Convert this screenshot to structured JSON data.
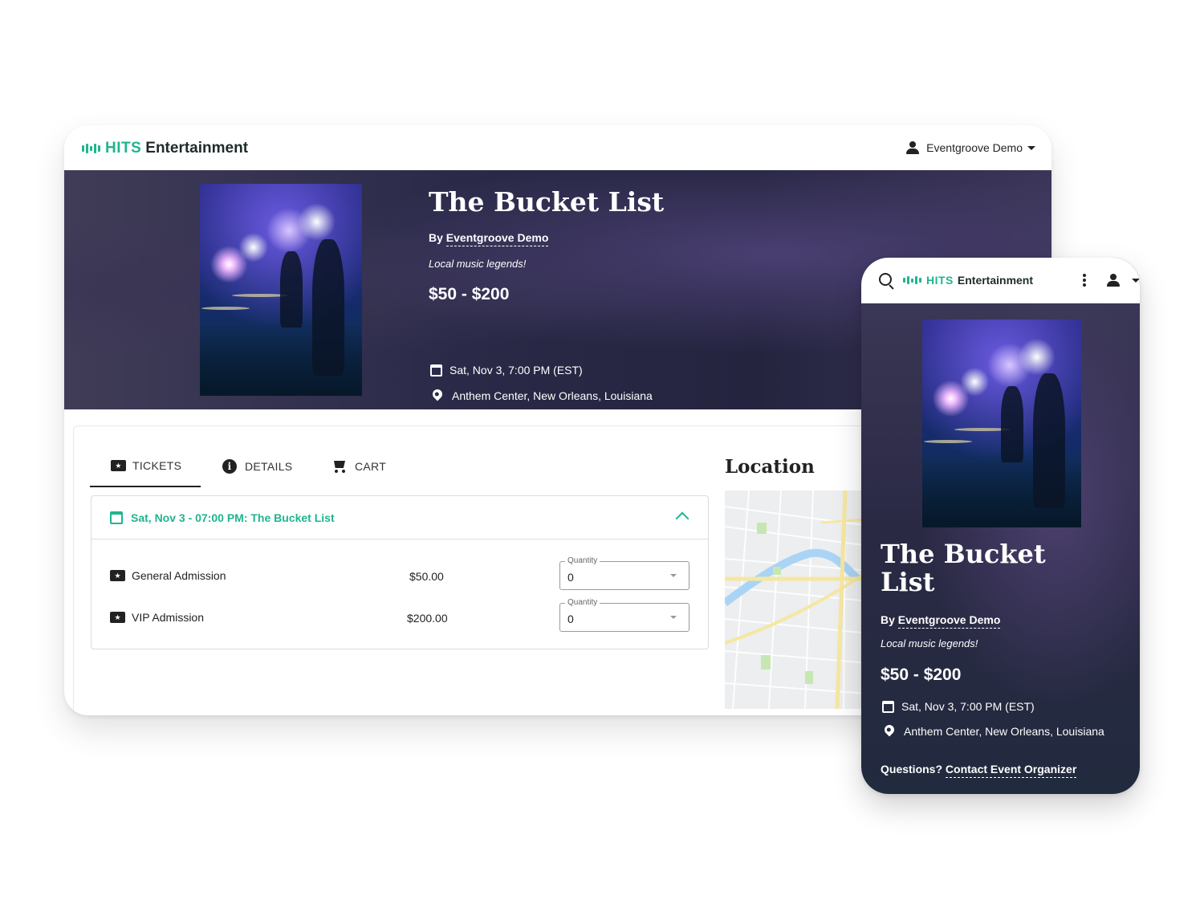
{
  "brand": {
    "hits": "HITS",
    "name": "Entertainment",
    "accent_color": "#1fb58f"
  },
  "user": {
    "name": "Eventgroove Demo"
  },
  "event": {
    "title": "The Bucket List",
    "by_prefix": "By",
    "organizer": "Eventgroove Demo",
    "tagline": "Local music legends!",
    "price_range": "$50 - $200",
    "date_time": "Sat, Nov 3, 7:00 PM (EST)",
    "location": "Anthem Center, New Orleans, Louisiana"
  },
  "tabs": [
    {
      "label": "TICKETS",
      "icon": "ticket-icon",
      "active": true
    },
    {
      "label": "DETAILS",
      "icon": "info-icon",
      "active": false
    },
    {
      "label": "CART",
      "icon": "cart-icon",
      "active": false
    }
  ],
  "session": {
    "title": "Sat, Nov 3 - 07:00 PM: The Bucket List"
  },
  "tickets": [
    {
      "name": "General Admission",
      "price": "$50.00",
      "qty_label": "Quantity",
      "qty": "0"
    },
    {
      "name": "VIP Admission",
      "price": "$200.00",
      "qty_label": "Quantity",
      "qty": "0"
    }
  ],
  "location_heading": "Location",
  "mobile": {
    "title": "The Bucket List",
    "questions": "Questions?",
    "contact_link": "Contact Event Organizer"
  },
  "icons": [
    "search-icon",
    "kebab-menu-icon",
    "user-icon",
    "caret-down-icon",
    "calendar-icon",
    "map-pin-icon",
    "chevron-up-icon",
    "ticket-icon",
    "info-icon",
    "cart-icon"
  ]
}
